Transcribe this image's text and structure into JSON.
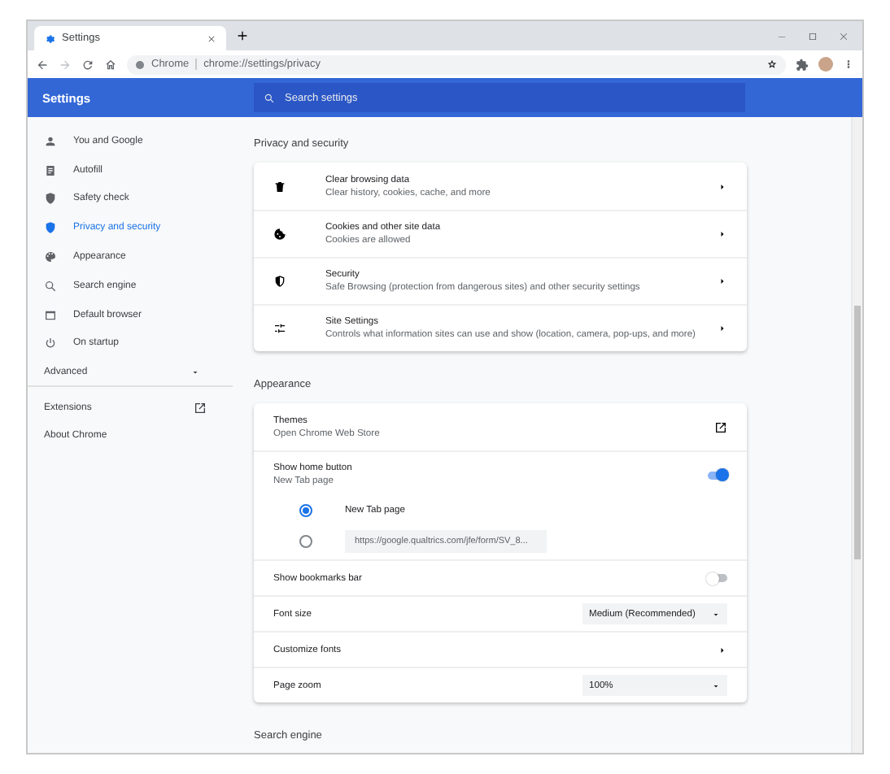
{
  "browser": {
    "tabs": [
      {
        "title": "Settings",
        "selected": true
      }
    ],
    "address": {
      "site_label": "Chrome",
      "url": "chrome://settings/privacy"
    }
  },
  "header": {
    "title": "Settings",
    "search_placeholder": "Search settings"
  },
  "sidebar": {
    "items": [
      {
        "label": "You and Google",
        "selected": false
      },
      {
        "label": "Autofill",
        "selected": false
      },
      {
        "label": "Safety check",
        "selected": false
      },
      {
        "label": "Privacy and security",
        "selected": true
      },
      {
        "label": "Appearance",
        "selected": false
      },
      {
        "label": "Search engine",
        "selected": false
      },
      {
        "label": "Default browser",
        "selected": false
      },
      {
        "label": "On startup",
        "selected": false
      }
    ],
    "advanced": {
      "label": "Advanced",
      "expanded": false
    },
    "links": [
      {
        "label": "Extensions",
        "external": true
      },
      {
        "label": "About Chrome",
        "external": false
      }
    ]
  },
  "sections": [
    {
      "title": "Privacy and security",
      "rows": [
        {
          "kind": "nav",
          "label": "Clear browsing data",
          "sublabel": "Clear history, cookies, cache, and more"
        },
        {
          "kind": "nav",
          "label": "Cookies and other site data",
          "sublabel": "Cookies are allowed"
        },
        {
          "kind": "nav",
          "label": "Security",
          "sublabel": "Safe Browsing (protection from dangerous sites) and other security settings"
        },
        {
          "kind": "nav",
          "label": "Site Settings",
          "sublabel": "Controls what information sites can use and show (location, camera, pop-ups, and more)"
        }
      ]
    },
    {
      "title": "Appearance",
      "rows": [
        {
          "kind": "link",
          "label": "Themes",
          "sublabel": "Open Chrome Web Store"
        },
        {
          "kind": "toggle",
          "label": "Show home button",
          "sublabel": "New Tab page",
          "on": true
        },
        {
          "kind": "radio",
          "label": "New Tab page",
          "selected": true
        },
        {
          "kind": "radio",
          "value": "https://google.qualtrics.com/jfe/form/SV_8...",
          "selected": false
        },
        {
          "kind": "toggle",
          "label": "Show bookmarks bar",
          "on": false
        },
        {
          "kind": "select",
          "label": "Font size",
          "value": "Medium (Recommended)"
        },
        {
          "kind": "nav",
          "label": "Customize fonts"
        },
        {
          "kind": "select",
          "label": "Page zoom",
          "value": "100%"
        }
      ]
    },
    {
      "title": "Search engine"
    }
  ]
}
